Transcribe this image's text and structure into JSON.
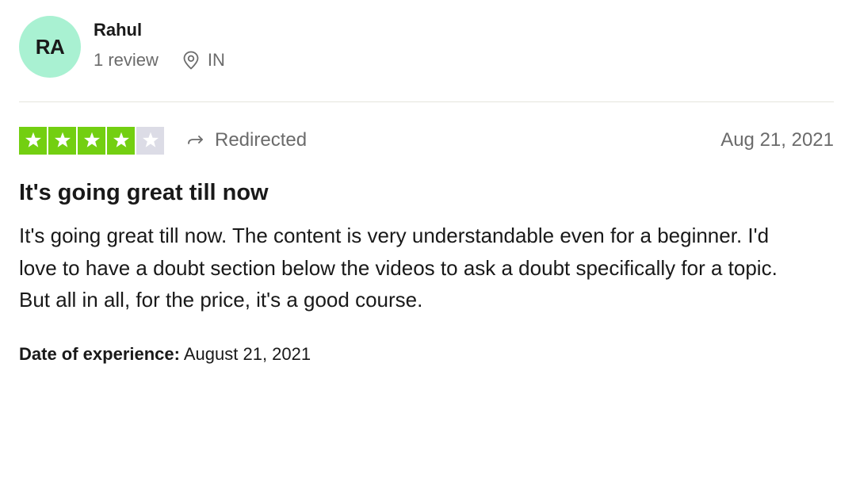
{
  "reviewer": {
    "initials": "RA",
    "name": "Rahul",
    "review_count": "1 review",
    "country": "IN",
    "avatar_color": "#a9f1d2"
  },
  "review": {
    "rating": 4,
    "max_rating": 5,
    "redirected_label": "Redirected",
    "date": "Aug 21, 2021",
    "title": "It's going great till now",
    "body": "It's going great till now. The content is very understandable even for a beginner. I'd love to have a doubt section below the videos to ask a doubt specifically for a topic. But all in all, for the price, it's a good course.",
    "experience_label": "Date of experience:",
    "experience_date": "August 21, 2021"
  },
  "colors": {
    "star_on": "#73cf11",
    "star_off": "#dcdce6",
    "muted_text": "#6b6b6b",
    "divider": "#e5e5dd"
  },
  "icons": {
    "location": "location-pin-icon",
    "redirected": "redirect-arrow-icon",
    "star": "star-icon"
  }
}
